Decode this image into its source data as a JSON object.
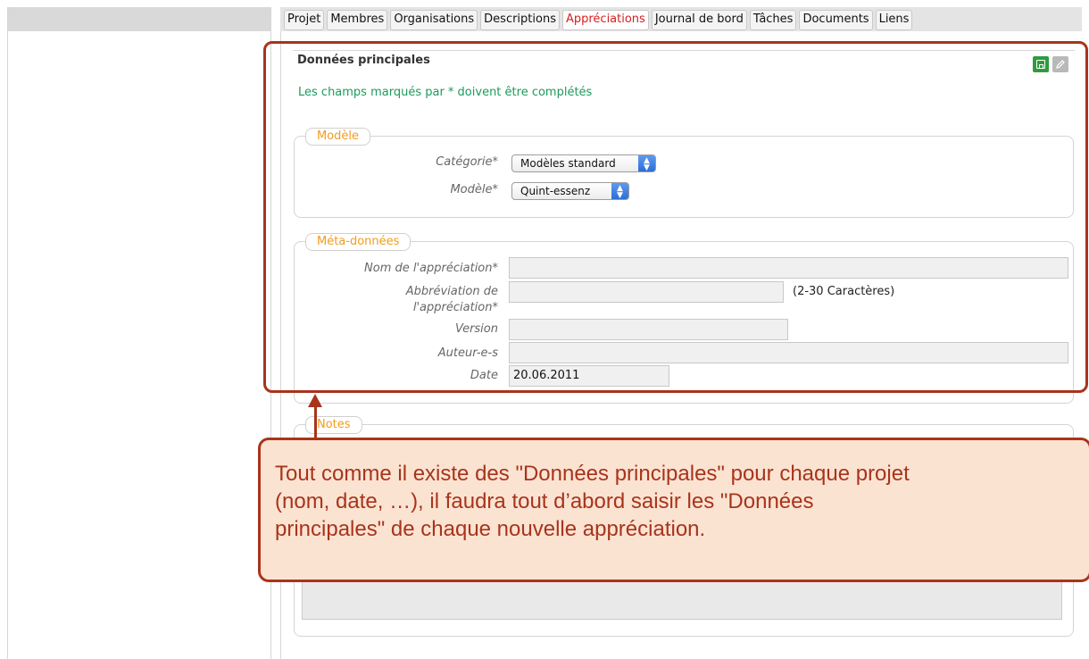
{
  "tabs": [
    {
      "label": "Projet"
    },
    {
      "label": "Membres"
    },
    {
      "label": "Organisations"
    },
    {
      "label": "Descriptions"
    },
    {
      "label": "Appréciations",
      "active": true
    },
    {
      "label": "Journal de bord"
    },
    {
      "label": "Tâches"
    },
    {
      "label": "Documents"
    },
    {
      "label": "Liens"
    }
  ],
  "section": {
    "title": "Données principales",
    "required_note": "Les champs marqués par * doivent être complétés",
    "icons": [
      "save-icon",
      "edit-icon"
    ]
  },
  "modele": {
    "legend": "Modèle",
    "categorie_label": "Catégorie*",
    "categorie_value": "Modèles standard",
    "modele_label": "Modèle*",
    "modele_value": "Quint-essenz"
  },
  "meta": {
    "legend": "Méta-données",
    "nom_label": "Nom de l'appréciation*",
    "nom_value": "",
    "abbr_label_1": "Abbréviation de",
    "abbr_label_2": "l'appréciation*",
    "abbr_value": "",
    "abbr_hint": "(2-30 Caractères)",
    "version_label": "Version",
    "version_value": "",
    "auteurs_label": "Auteur-e-s",
    "auteurs_value": "",
    "date_label": "Date",
    "date_value": "20.06.2011"
  },
  "notes": {
    "legend": "Notes"
  },
  "callout": {
    "line1": "Tout comme il existe des \"Données principales\" pour chaque projet",
    "line2": "(nom, date, …), il faudra tout d’abord saisir les \"Données",
    "line3": "principales\" de chaque nouvelle appréciation."
  },
  "colors": {
    "accent_orange": "#f29b1d",
    "active_tab": "#d81e1e",
    "note_green": "#1d9a5c",
    "callout_border": "#a8341c",
    "callout_fill": "#fbe3d2"
  }
}
